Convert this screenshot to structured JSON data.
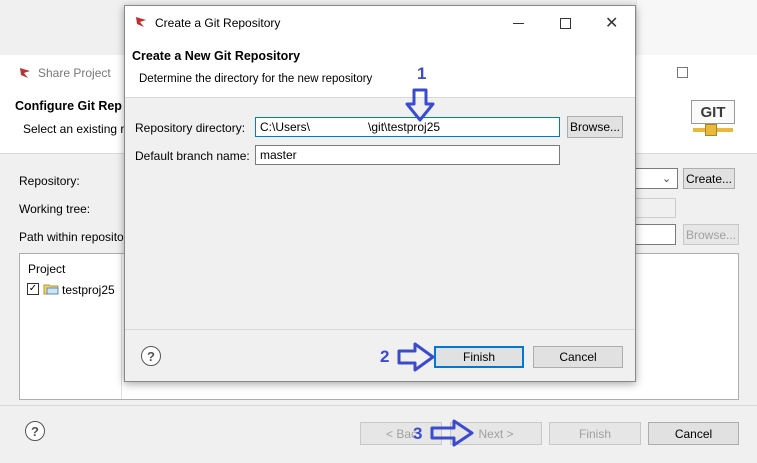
{
  "share": {
    "title": "Share Project",
    "heading": "Configure Git Rep",
    "subtitle": "Select an existing re",
    "repository_label": "Repository:",
    "working_tree_label": "Working tree:",
    "path_label": "Path within reposito",
    "create_btn": "Create...",
    "browse_btn": "Browse...",
    "project_col": "Project",
    "project_item": "testproj25",
    "back_btn": "< Bac",
    "next_btn": "Next >",
    "finish_btn": "Finish",
    "cancel_btn": "Cancel"
  },
  "git": {
    "title": "Create a Git Repository",
    "heading": "Create a New Git Repository",
    "subtitle": "Determine the directory for the new repository",
    "repo_dir_label": "Repository directory:",
    "repo_dir_value": "C:\\Users\\",
    "repo_dir_value_tail": "\\git\\testproj25",
    "branch_label": "Default branch name:",
    "branch_value": "master",
    "browse_btn": "Browse...",
    "finish_btn": "Finish",
    "cancel_btn": "Cancel",
    "git_icon_text": "GIT"
  },
  "annotations": {
    "one": "1",
    "two": "2",
    "three": "3"
  },
  "colors": {
    "annotation": "#3a4bd1",
    "focus": "#0078d7"
  }
}
